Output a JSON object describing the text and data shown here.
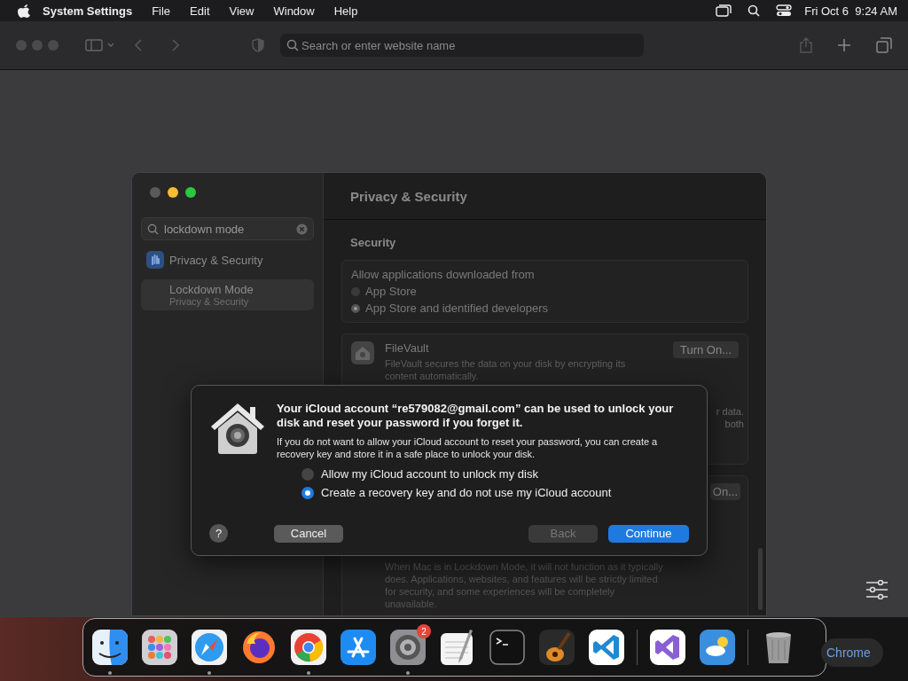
{
  "menu_bar": {
    "app": "System Settings",
    "menus": [
      "File",
      "Edit",
      "View",
      "Window",
      "Help"
    ],
    "clock": "Fri Oct 6  9:24 AM"
  },
  "browser": {
    "address_placeholder": "Search or enter website name"
  },
  "settings": {
    "search_value": "lockdown mode",
    "sidebar_items": [
      {
        "label": "Privacy & Security",
        "selected": false
      },
      {
        "label": "Lockdown Mode",
        "sublabel": "Privacy & Security",
        "selected": true
      }
    ],
    "header": "Privacy & Security",
    "section": "Security",
    "allow_label": "Allow applications downloaded from",
    "radios": [
      {
        "label": "App Store",
        "selected": false
      },
      {
        "label": "App Store and identified developers",
        "selected": true
      }
    ],
    "filevault": {
      "title": "FileVault",
      "description": "FileVault secures the data on your disk by encrypting its content automatically.",
      "button": "Turn On..."
    },
    "card_fragments": [
      "r data.",
      "both"
    ],
    "card_button": "On...",
    "lockdown_description": "When Mac is in Lockdown Mode, it will not function as it typically does. Applications, websites, and features will be strictly limited for security, and some experiences will be completely unavailable."
  },
  "dialog": {
    "title": "Your iCloud account “re579082@gmail.com” can be used to unlock your disk and reset your password if you forget it.",
    "body": "If you do not want to allow your iCloud account to reset your password, you can create a recovery key and store it in a safe place to unlock your disk.",
    "options": [
      {
        "label": "Allow my iCloud account to unlock my disk",
        "selected": false
      },
      {
        "label": "Create a recovery key and do not use my iCloud account",
        "selected": true
      }
    ],
    "help": "?",
    "buttons": [
      {
        "label": "Cancel",
        "kind": "normal"
      },
      {
        "label": "Back",
        "kind": "disabled"
      },
      {
        "label": "Continue",
        "kind": "default"
      }
    ]
  },
  "dock": {
    "apps": [
      {
        "kind": "finder",
        "running": true
      },
      {
        "kind": "launchpad",
        "running": false
      },
      {
        "kind": "safari",
        "running": true
      },
      {
        "kind": "firefox",
        "running": false
      },
      {
        "kind": "chrome",
        "running": true
      },
      {
        "kind": "appstore",
        "running": false
      },
      {
        "kind": "settings",
        "running": true,
        "badge": "2"
      },
      {
        "kind": "textedit",
        "running": false
      },
      {
        "kind": "terminal",
        "running": false
      },
      {
        "kind": "garageband",
        "running": false
      },
      {
        "kind": "vscode",
        "running": false
      },
      {
        "kind": "separator"
      },
      {
        "kind": "visualstudio",
        "running": false
      },
      {
        "kind": "weather",
        "running": false
      },
      {
        "kind": "separator"
      },
      {
        "kind": "trash",
        "running": false
      }
    ]
  },
  "desktop_label": "Chrome"
}
